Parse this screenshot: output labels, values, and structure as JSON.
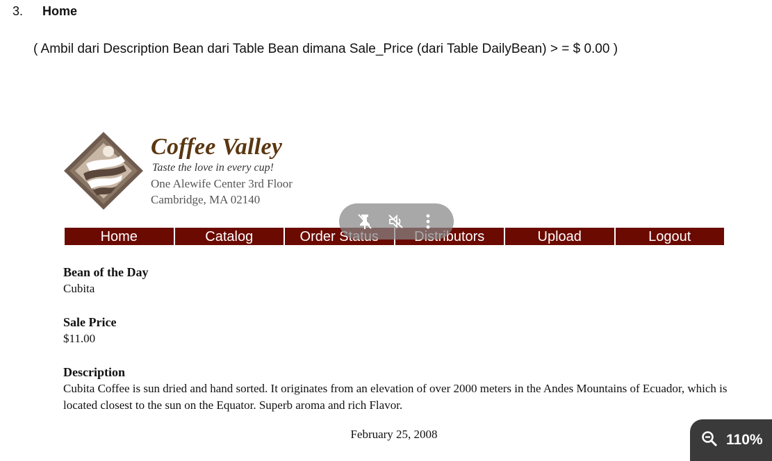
{
  "section": {
    "number": "3.",
    "title": "Home"
  },
  "note": "( Ambil dari Description Bean dari Table Bean dimana Sale_Price (dari Table DailyBean) > = $ 0.00 )",
  "brand": {
    "name": "Coffee Valley",
    "tagline": "Taste the love in every cup!",
    "address_line1": "One Alewife Center 3rd Floor",
    "address_line2": "Cambridge,  MA 02140"
  },
  "nav": {
    "items": [
      "Home",
      "Catalog",
      "Order Status",
      "Distributors",
      "Upload",
      "Logout"
    ]
  },
  "bean_of_day": {
    "label": "Bean of the Day",
    "value": "Cubita"
  },
  "sale_price": {
    "label": "Sale Price",
    "value": "$11.00"
  },
  "description": {
    "label": "Description",
    "value": "Cubita Coffee is sun dried and hand sorted. It originates from an elevation of over 2000 meters in the Andes Mountains of Ecuador, which is located closest to the sun on the Equator. Superb aroma and rich Flavor."
  },
  "date": "February 25, 2008",
  "video_overlay": {
    "icons": [
      "unpin-icon",
      "mute-icon",
      "more-vertical-icon"
    ]
  },
  "zoom": {
    "icon": "zoom-out-icon",
    "level": "110%"
  },
  "colors": {
    "nav_bg": "#6b0a00",
    "brand_text": "#5a3710",
    "overlay_bg": "#878787",
    "zoom_bg": "#3a3a3a"
  }
}
